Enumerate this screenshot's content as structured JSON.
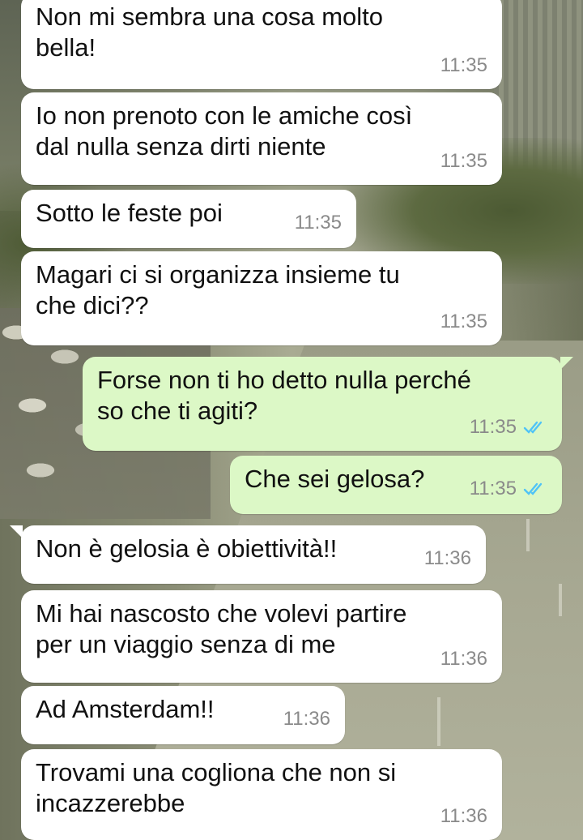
{
  "messages": [
    {
      "dir": "in",
      "text": "Non mi sembra una cosa molto\nbella!",
      "time": "11:35"
    },
    {
      "dir": "in",
      "text": "Io non prenoto con le amiche così\ndal nulla senza dirti niente",
      "time": "11:35"
    },
    {
      "dir": "in",
      "text": "Sotto le feste poi",
      "time": "11:35"
    },
    {
      "dir": "in",
      "text": "Magari ci si organizza insieme tu\nche dici??",
      "time": "11:35"
    },
    {
      "dir": "out",
      "text": "Forse non ti ho detto nulla perché\nso che ti agiti?",
      "time": "11:35",
      "status": "read"
    },
    {
      "dir": "out",
      "text": "Che sei gelosa?",
      "time": "11:35",
      "status": "read"
    },
    {
      "dir": "in",
      "text": "Non è gelosia è obiettività!!",
      "time": "11:36"
    },
    {
      "dir": "in",
      "text": "Mi hai nascosto che volevi partire\nper un viaggio senza di me",
      "time": "11:36"
    },
    {
      "dir": "in",
      "text": "Ad Amsterdam!!",
      "time": "11:36"
    },
    {
      "dir": "in",
      "text": "Trovami una cogliona che non si\nincazzerebbe",
      "time": "11:36"
    }
  ],
  "colors": {
    "incoming_bubble": "#ffffff",
    "outgoing_bubble": "#dcf8c6",
    "read_tick": "#4fc3f7",
    "timestamp": "#8a8a8a"
  },
  "icons": {
    "read_receipt": "double-check-icon"
  }
}
